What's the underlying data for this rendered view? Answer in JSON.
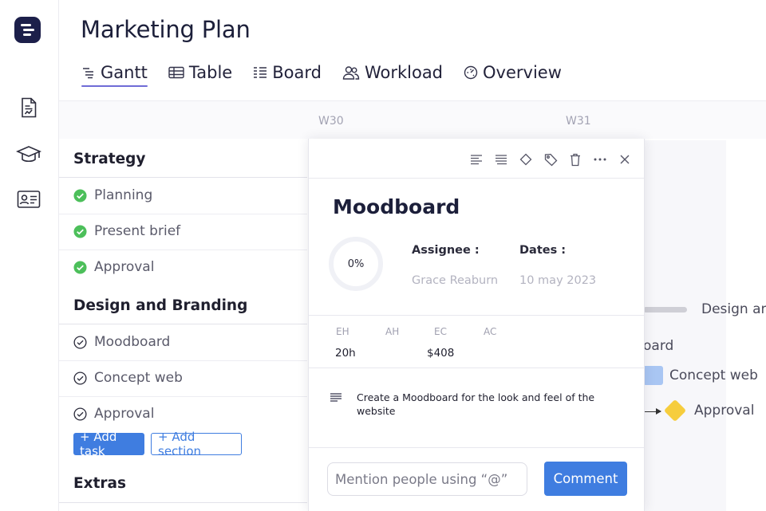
{
  "app": {
    "title": "Marketing Plan"
  },
  "tabs": [
    {
      "label": "Gantt",
      "icon": "gantt-icon",
      "active": true
    },
    {
      "label": "Table",
      "icon": "table-icon"
    },
    {
      "label": "Board",
      "icon": "board-icon"
    },
    {
      "label": "Workload",
      "icon": "workload-icon"
    },
    {
      "label": "Overview",
      "icon": "overview-icon"
    }
  ],
  "weeks": [
    "W30",
    "W31"
  ],
  "sections": [
    {
      "name": "Strategy",
      "tasks": [
        {
          "name": "Planning",
          "status": "done"
        },
        {
          "name": "Present brief",
          "status": "done"
        },
        {
          "name": "Approval",
          "status": "done"
        }
      ]
    },
    {
      "name": "Design and Branding",
      "tasks": [
        {
          "name": "Moodboard",
          "status": "open"
        },
        {
          "name": "Concept web",
          "status": "open"
        },
        {
          "name": "Approval",
          "status": "open"
        }
      ]
    },
    {
      "name": "Extras",
      "tasks": []
    }
  ],
  "list_actions": {
    "add_task": "+ Add task",
    "add_section": "+ Add section"
  },
  "gantt": {
    "section_label": "Design and",
    "items": [
      "oard",
      "Concept web",
      "Approval"
    ]
  },
  "detail": {
    "title": "Moodboard",
    "progress": "0%",
    "assignee_label": "Assignee :",
    "assignee": "Grace Reaburn",
    "dates_label": "Dates :",
    "date": "10 may 2023",
    "metrics": [
      {
        "label": "EH",
        "value": "20h"
      },
      {
        "label": "AH",
        "value": ""
      },
      {
        "label": "EC",
        "value": "$408"
      },
      {
        "label": "AC",
        "value": ""
      }
    ],
    "description": "Create a Moodboard for the look and feel of the website",
    "comment_placeholder": "Mention people using “@”",
    "comment_button": "Comment"
  },
  "colors": {
    "accent": "#3f7de0",
    "tab_underline": "#6f6cd6",
    "done": "#4cbf5a",
    "milestone": "#f6cd3d",
    "logo_bg": "#1c1f4a"
  }
}
